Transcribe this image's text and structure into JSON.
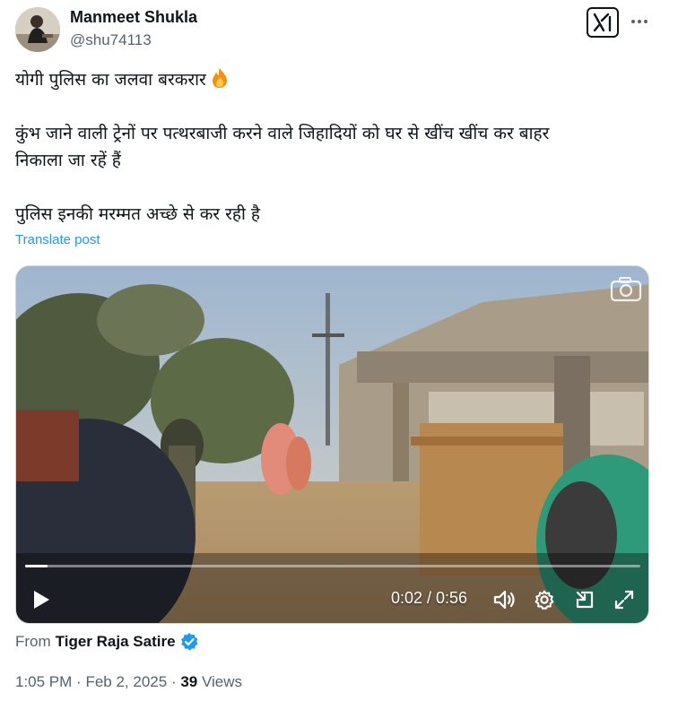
{
  "author": {
    "name": "Manmeet Shukla",
    "handle": "@shu74113"
  },
  "header_icons": {
    "grok": "grok-icon",
    "more": "more-dots-icon"
  },
  "post": {
    "line1": "योगी पुलिस का जलवा बरकरार",
    "emoji": "fire-emoji-icon",
    "line2": "कुंभ जाने वाली ट्रेनों पर पत्थरबाजी करने वाले जिहादियों को घर से खींच खींच कर बाहर",
    "line3": "निकाला जा रहें हैं",
    "line4": "पुलिस इनकी मरम्मत अच्छे से कर रही है",
    "translate_label": "Translate post"
  },
  "video": {
    "elapsed": "0:02",
    "duration": "0:56",
    "time_display": "0:02 / 0:56",
    "progress_fraction": 0.036
  },
  "source": {
    "prefix": "From",
    "name": "Tiger Raja Satire",
    "verified_color": "#1d9bf0"
  },
  "meta": {
    "time": "1:05 PM",
    "separator": "·",
    "date": "Feb 2, 2025",
    "views_count": "39",
    "views_label": "Views"
  },
  "colors": {
    "link": "#1d9bf0",
    "secondary_text": "#536471",
    "primary_text": "#0f1419"
  }
}
